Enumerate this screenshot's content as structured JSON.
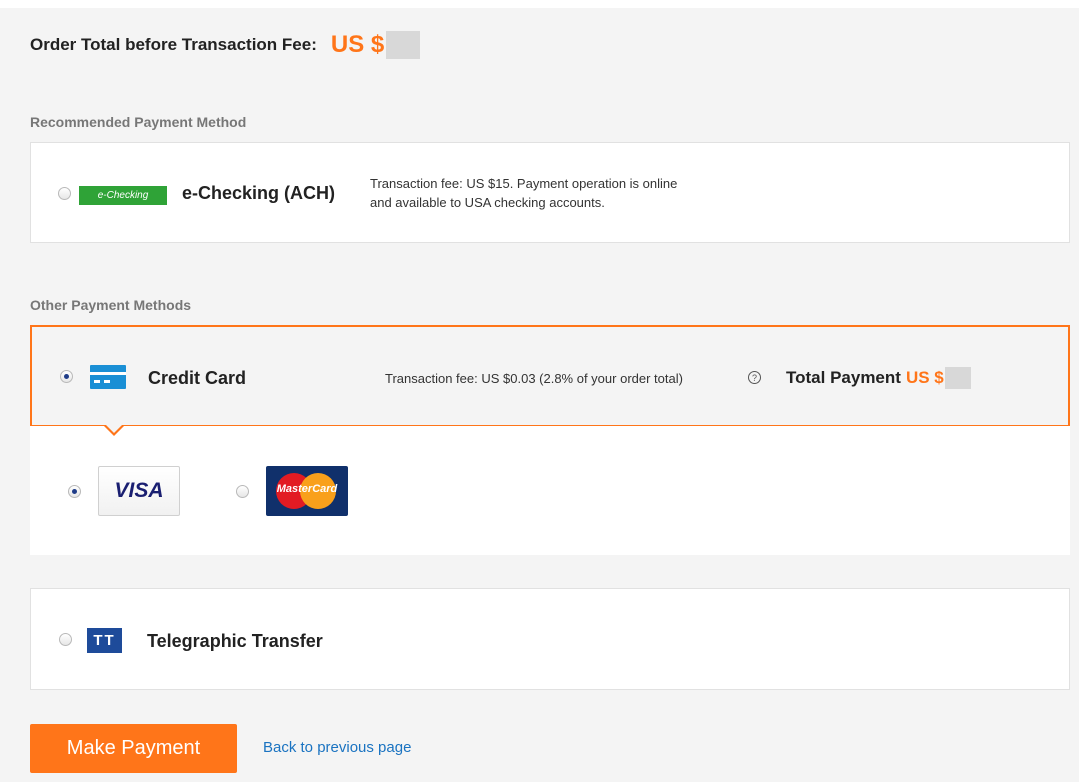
{
  "order_total": {
    "label": "Order Total before Transaction Fee:",
    "currency": "US $"
  },
  "recommended": {
    "section_label": "Recommended Payment Method",
    "echecking": {
      "logo_text": "e-Checking",
      "title": "e-Checking (ACH)",
      "description_line1": "Transaction fee: US $15. Payment operation is online",
      "description_line2": "and available to USA checking accounts.",
      "selected": false
    }
  },
  "other": {
    "section_label": "Other Payment Methods",
    "credit_card": {
      "title": "Credit Card",
      "fee_text": "Transaction fee: US $0.03 (2.8% of your order total)",
      "help_glyph": "?",
      "total_label": "Total Payment",
      "total_currency": "US $",
      "selected": true,
      "brands": [
        {
          "name": "VISA",
          "selected": true
        },
        {
          "name": "MasterCard",
          "selected": false
        }
      ]
    },
    "telegraphic": {
      "icon_text": "TT",
      "title": "Telegraphic Transfer",
      "selected": false
    }
  },
  "actions": {
    "make_payment_label": "Make Payment",
    "back_label": "Back to previous page"
  },
  "colors": {
    "accent": "#ff7519",
    "link": "#1a73c1",
    "echeck_green": "#2fa337",
    "card_blue": "#1a8fd5",
    "tt_blue": "#1e4b9a"
  }
}
